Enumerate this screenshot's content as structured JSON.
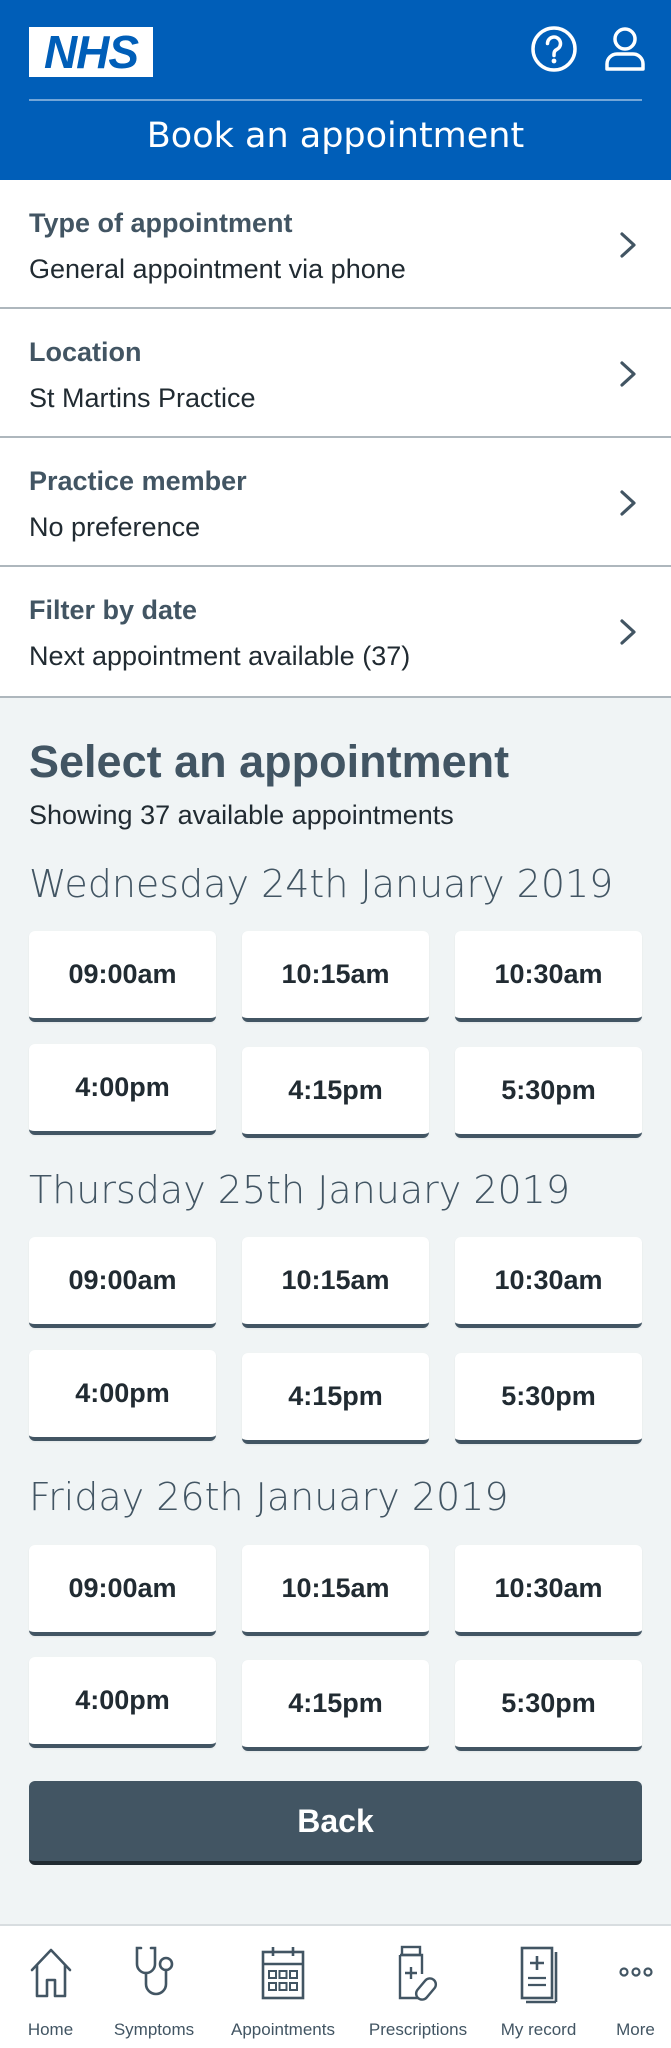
{
  "header": {
    "logo": "NHS",
    "title": "Book an appointment"
  },
  "filters": [
    {
      "label": "Type of appointment",
      "value": "General appointment via phone"
    },
    {
      "label": "Location",
      "value": "St Martins Practice"
    },
    {
      "label": "Practice member",
      "value": "No preference"
    },
    {
      "label": "Filter by date",
      "value": "Next appointment available (37)"
    }
  ],
  "select": {
    "title": "Select an appointment",
    "subtitle": "Showing 37 available appointments"
  },
  "days": [
    {
      "date": "Wednesday 24th January 2019",
      "slots": [
        "09:00am",
        "10:15am",
        "10:30am",
        "4:00pm",
        "4:15pm",
        "5:30pm"
      ]
    },
    {
      "date": "Thursday 25th January 2019",
      "slots": [
        "09:00am",
        "10:15am",
        "10:30am",
        "4:00pm",
        "4:15pm",
        "5:30pm"
      ]
    },
    {
      "date": "Friday 26th January 2019",
      "slots": [
        "09:00am",
        "10:15am",
        "10:30am",
        "4:00pm",
        "4:15pm",
        "5:30pm"
      ]
    }
  ],
  "back_label": "Back",
  "nav": [
    {
      "label": "Home",
      "icon": "home-icon"
    },
    {
      "label": "Symptoms",
      "icon": "stethoscope-icon"
    },
    {
      "label": "Appointments",
      "icon": "calendar-icon"
    },
    {
      "label": "Prescriptions",
      "icon": "medicine-icon"
    },
    {
      "label": "My record",
      "icon": "record-icon"
    },
    {
      "label": "More",
      "icon": "more-icon"
    }
  ],
  "colors": {
    "brand": "#005eb8",
    "text_secondary": "#425563",
    "background": "#f0f4f5"
  }
}
